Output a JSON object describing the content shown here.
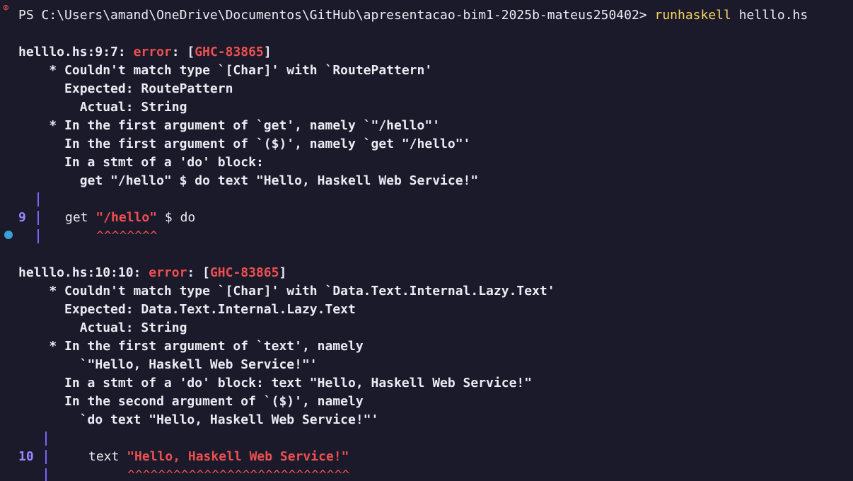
{
  "prompt": {
    "path": "PS C:\\Users\\amand\\OneDrive\\Documentos\\GitHub\\apresentacao-bim1-2025b-mateus250402>",
    "command": "runhaskell",
    "arg": "helllo.hs"
  },
  "error1": {
    "loc": "helllo.hs:9:7:",
    "label": "error",
    "code": "GHC-83865",
    "lines": [
      "    * Couldn't match type `[Char]' with `RoutePattern'",
      "      Expected: RoutePattern",
      "        Actual: String",
      "    * In the first argument of `get', namely `\"/hello\"'",
      "      In the first argument of `($)', namely `get \"/hello\"'",
      "      In a stmt of a 'do' block:",
      "        get \"/hello\" $ do text \"Hello, Haskell Web Service!\""
    ],
    "src_lineno": "9",
    "src_pre": "get ",
    "src_hl": "\"/hello\"",
    "src_post": " $ do",
    "carets": "^^^^^^^^"
  },
  "error2": {
    "loc": "helllo.hs:10:10:",
    "label": "error",
    "code": "GHC-83865",
    "lines": [
      "    * Couldn't match type `[Char]' with `Data.Text.Internal.Lazy.Text'",
      "      Expected: Data.Text.Internal.Lazy.Text",
      "        Actual: String",
      "    * In the first argument of `text', namely",
      "        `\"Hello, Haskell Web Service!\"'",
      "      In a stmt of a 'do' block: text \"Hello, Haskell Web Service!\"",
      "      In the second argument of `($)', namely",
      "        `do text \"Hello, Haskell Web Service!\"'"
    ],
    "src_lineno": "10",
    "src_pre": "text ",
    "src_hl": "\"Hello, Haskell Web Service!\"",
    "carets": "^^^^^^^^^^^^^^^^^^^^^^^^^^^^^"
  },
  "colors": {
    "background": "#1b1a2b",
    "foreground": "#eceaf2",
    "command": "#f4d35e",
    "error": "#ef4f4f",
    "gutter": "#7a63ff",
    "line_number": "#9a86ff",
    "status_dot": "#3aa0d8"
  }
}
